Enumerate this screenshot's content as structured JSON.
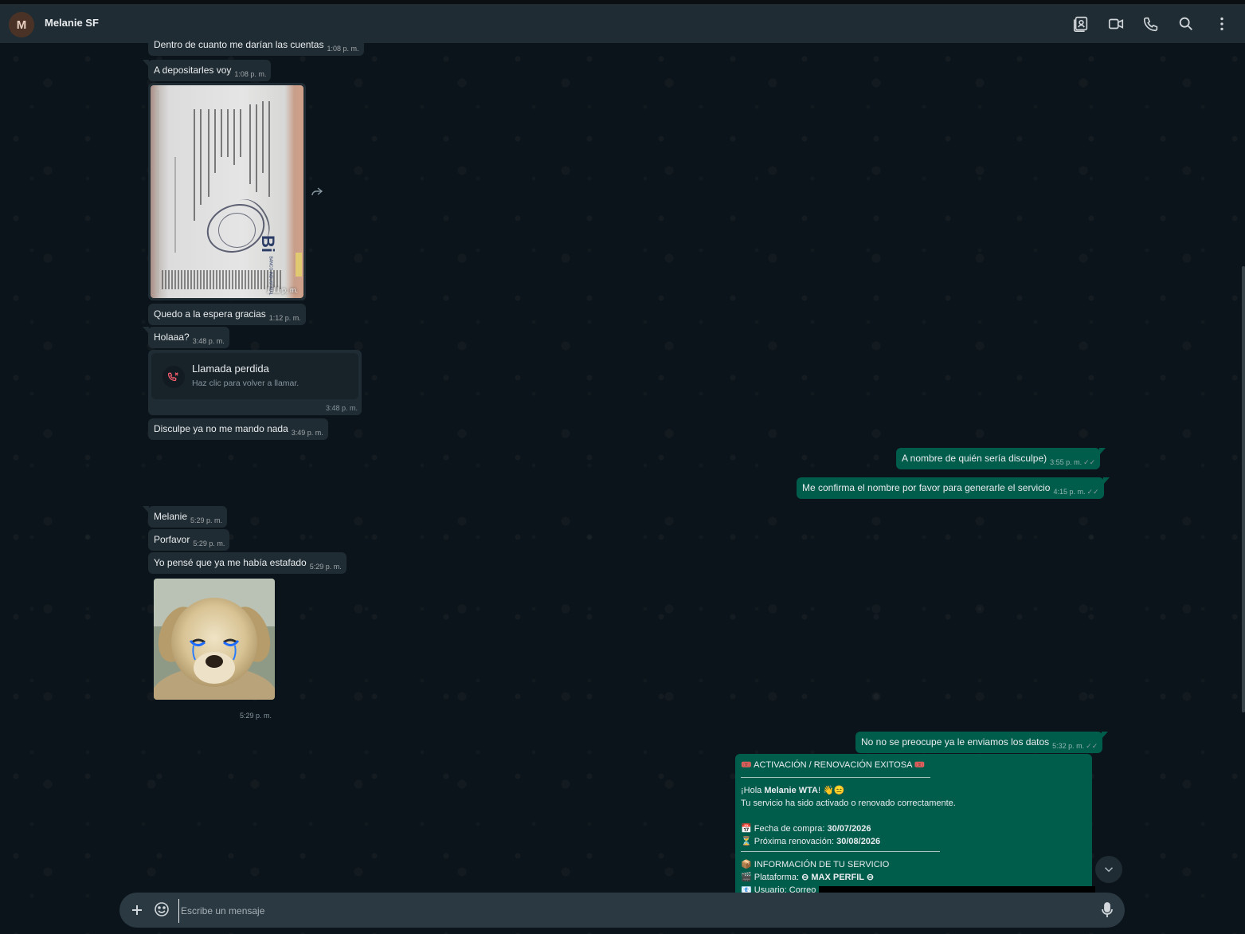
{
  "header": {
    "avatar_letter": "M",
    "contact_name": "Melanie SF",
    "icons": [
      "contact-card-icon",
      "video-call-icon",
      "voice-call-icon",
      "search-icon",
      "menu-icon"
    ]
  },
  "messages": [
    {
      "text": "Dentro de cuanto me darían las cuentas",
      "time": "1:08 p. m."
    },
    {
      "text": "A depositarles voy",
      "time": "1:08 p. m."
    },
    {
      "text": "",
      "time": "1:11 p. m."
    },
    {
      "text": "Quedo a la espera gracias",
      "time": "1:12 p. m."
    },
    {
      "text": "Holaaa?",
      "time": "3:48 p. m."
    },
    {
      "text": "Disculpe ya no me mando nada",
      "time": "3:49 p. m."
    },
    {
      "text": "A nombre de quién sería disculpe)",
      "time": "3:55 p. m."
    },
    {
      "text": "Me confirma el nombre por favor para generarle el servicio",
      "time": "4:15 p. m."
    },
    {
      "text": "Melanie",
      "time": "5:29 p. m."
    },
    {
      "text": "Porfavor",
      "time": "5:29 p. m."
    },
    {
      "text": "Yo pensé que ya me había estafado",
      "time": "5:29 p. m."
    },
    {
      "text": "",
      "time": "5:29 p. m."
    },
    {
      "text": "No no se preocupe ya le enviamos los datos",
      "time": "5:32 p. m."
    }
  ],
  "missed_call": {
    "title": "Llamada perdida",
    "subtitle": "Haz clic para volver a llamar.",
    "time": "3:48 p. m."
  },
  "receipt_print": {
    "logo": "Bi",
    "bank": "BANCO INDUSTRIAL"
  },
  "card": {
    "title": "ACTIVACIÓN / RENOVACIÓN EXITOSA",
    "greeting_prefix": "¡Hola ",
    "greeting_name": "Melanie WTA",
    "greeting_suffix": "! 👋😑",
    "intro": "Tu servicio ha sido activado o renovado correctamente.",
    "purchase_label": "Fecha de compra:",
    "purchase_value": "30/07/2026",
    "renewal_label": "Próxima renovación:",
    "renewal_value": "30/08/2026",
    "info_title": "INFORMACIÓN DE TU SERVICIO",
    "platform_label": "Plataforma:",
    "platform_value": "⊖ MAX PERFIL ⊖",
    "user_label": "Usuario: Correo"
  },
  "composer": {
    "placeholder": "Escribe un mensaje"
  },
  "colors": {
    "incoming": "#202c33",
    "outgoing": "#005c4b",
    "background": "#0b141a",
    "missed_call_red": "#f15c6d",
    "read_tick": "#8a9aa1"
  }
}
